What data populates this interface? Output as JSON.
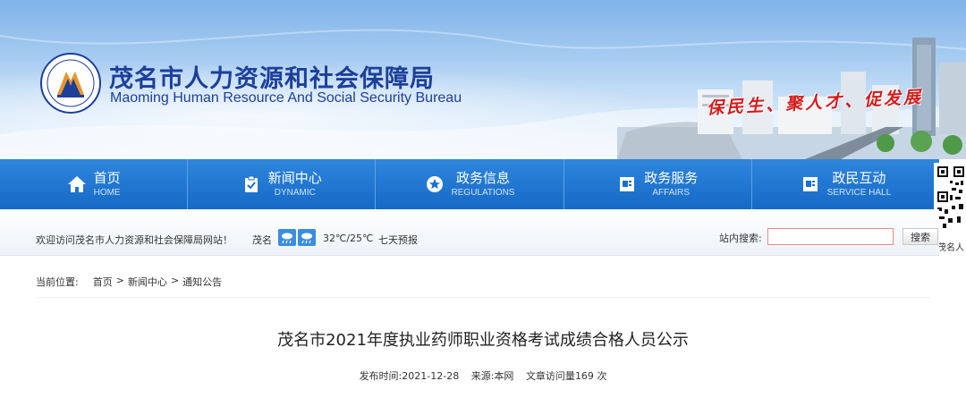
{
  "header": {
    "title": "茂名市人力资源和社会保障局",
    "subtitle": "Maoming Human Resource And Social Security Bureau",
    "slogan": "保民生、聚人才、促发展",
    "logo_icon": "bureau-emblem",
    "colors": {
      "title": "#1d3f9a",
      "slogan": "#d61b1b",
      "nav": "#1a6fcc"
    }
  },
  "nav": {
    "items": [
      {
        "label": "首页",
        "en": "HOME",
        "icon": "home-icon"
      },
      {
        "label": "新闻中心",
        "en": "DYNAMIC",
        "icon": "clipboard-check-icon"
      },
      {
        "label": "政务信息",
        "en": "REGULATIONS",
        "icon": "star-circle-icon"
      },
      {
        "label": "政务服务",
        "en": "AFFAIRS",
        "icon": "document-icon"
      },
      {
        "label": "政民互动",
        "en": "SERVICE HALL",
        "icon": "document-icon"
      }
    ]
  },
  "qr": {
    "caption": "茂名人"
  },
  "info_bar": {
    "welcome": "欢迎访问茂名市人力资源和社会保障局网站！",
    "city": "茂名",
    "weather_icons": [
      "cloud-rain-icon",
      "cloud-rain-icon"
    ],
    "temperature": "32℃/25℃",
    "forecast": "七天预报",
    "search_label": "站内搜索:",
    "search_placeholder": "",
    "search_button": "搜索"
  },
  "breadcrumb": {
    "prefix": "当前位置:",
    "items": [
      "首页",
      "新闻中心",
      "通知公告"
    ],
    "separator": ">"
  },
  "article": {
    "title": "茂名市2021年度执业药师职业资格考试成绩合格人员公示",
    "publish_label": "发布时间:",
    "publish_date": "2021-12-28",
    "source_label": "来源:",
    "source": "本网",
    "views_label": "文章访问量",
    "views": "169",
    "views_unit": "次"
  }
}
